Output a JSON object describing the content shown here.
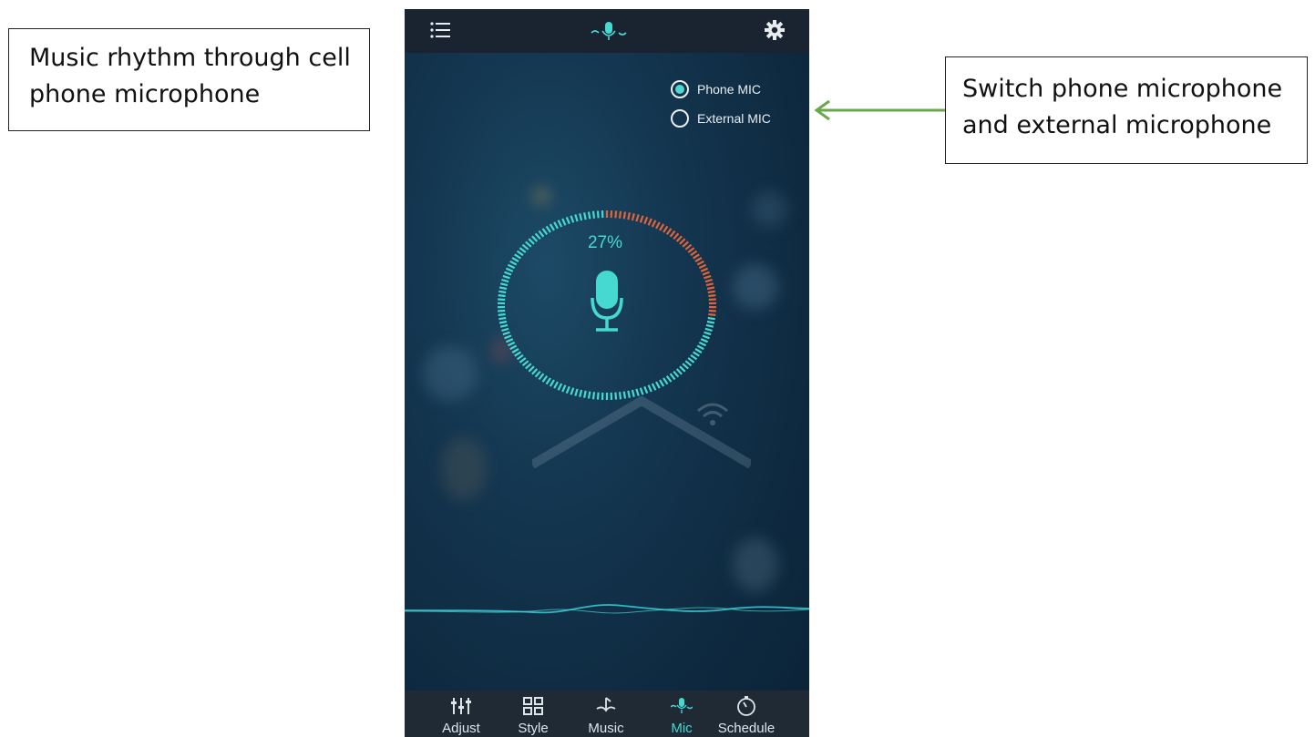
{
  "annotations": {
    "left_text": "Music rhythm through cell phone microphone",
    "right_text": "Switch phone microphone and external microphone"
  },
  "app": {
    "mic_options": [
      {
        "label": "Phone MIC",
        "selected": true
      },
      {
        "label": "External MIC",
        "selected": false
      }
    ],
    "level_percent": "27%",
    "level_fraction": 0.27,
    "tabs": [
      {
        "label": "Adjust",
        "icon": "sliders-icon",
        "active": false
      },
      {
        "label": "Style",
        "icon": "grid-icon",
        "active": false
      },
      {
        "label": "Music",
        "icon": "music-note-icon",
        "active": false
      },
      {
        "label": "Mic",
        "icon": "microphone-icon",
        "active": true
      },
      {
        "label": "Schedule",
        "icon": "timer-icon",
        "active": false
      }
    ]
  },
  "colors": {
    "accent": "#46d9d2",
    "level_warm": "#e0643c",
    "arrow": "#6aa84f"
  }
}
